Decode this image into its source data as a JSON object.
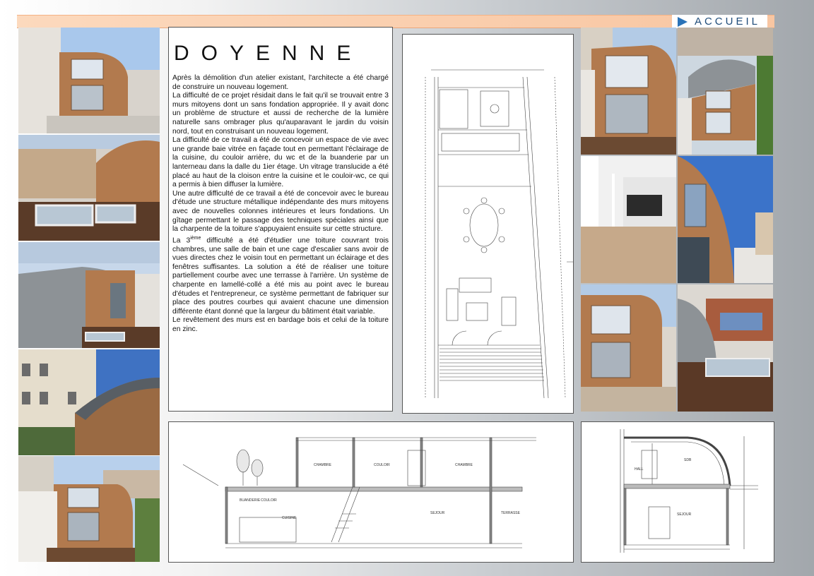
{
  "nav": {
    "accueil_label": "ACCUEIL",
    "arrow_color": "#2a73b8"
  },
  "project": {
    "title": "DOYENNE",
    "paragraphs": [
      "Après la démolition d'un atelier existant, l'architecte a été chargé de construire un nouveau logement.",
      "La difficulté de ce projet résidait dans le fait qu'il se trouvait entre 3 murs mitoyens dont un sans fondation appropriée. Il y avait donc un problème de structure et aussi de recherche de la lumière naturelle sans ombrager plus qu'auparavant le jardin du voisin nord, tout en construisant un nouveau logement.",
      "La difficulté de ce travail a été de concevoir un espace de vie avec une grande baie vitrée en façade tout en permettant l'éclairage de la cuisine, du couloir arrière, du wc et de la buanderie par un lanterneau dans la dalle du 1ier étage. Un vitrage translucide a été placé au haut de la cloison entre la cuisine et le couloir-wc, ce qui a permis à bien diffuser la lumière.",
      "Une autre difficulté de ce travail a été de concevoir avec le bureau d'étude une structure métallique indépendante des murs mitoyens avec de nouvelles colonnes intérieures et leurs fondations. Un gîtage permettant le passage des techniques spéciales ainsi que la charpente de la toiture s'appuyaient ensuite sur cette structure."
    ],
    "third_para_prefix": "La 3",
    "third_para_sup": "ième",
    "third_para_rest": " difficulté a été d'étudier une toiture couvrant trois chambres, une salle de bain et une cage d'escalier sans avoir de vues directes chez le voisin tout en permettant un éclairage et des fenêtres suffisantes. La solution a été de réaliser une toiture partiellement courbe avec une terrasse à l'arrière. Un système de charpente en lamellé-collé a été mis au point avec le bureau d'études et l'entrepreneur, ce système permettant de fabriquer sur place des poutres courbes qui avaient chacune une dimension différente étant donné que la largeur du bâtiment était variable.",
    "last_para": "Le revêtement des murs est en bardage bois et celui de la toiture en zinc."
  },
  "section_labels": {
    "chambre_1": "CHAMBRE",
    "couloir_1": "COULOIR",
    "chambre_2": "CHAMBRE",
    "buanderie": "BUANDERIE",
    "couloir_2": "COULOIR",
    "cuisine": "CUISINE",
    "sejour_1": "SEJOUR",
    "terrasse": "TERRASSE",
    "hall": "HALL",
    "sdb": "SDB",
    "sejour_2": "SEJOUR"
  },
  "colors": {
    "wood": "#b27a4e",
    "zinc": "#8d9296",
    "sky": "#5f8fcf",
    "header": "#f8c6a2"
  }
}
